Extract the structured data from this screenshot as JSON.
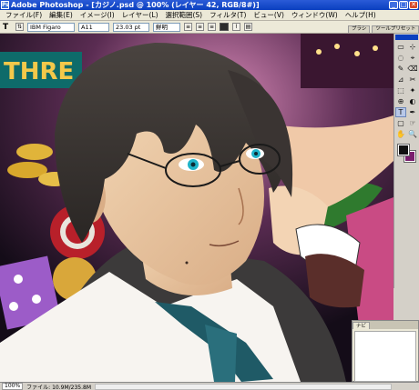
{
  "titlebar": {
    "title": "Adobe Photoshop - [カジノ.psd @ 100% (レイヤー 42, RGB/8#)]",
    "minimize": "_",
    "maximize": "□",
    "close": "✕"
  },
  "menu": [
    "ファイル(F)",
    "編集(E)",
    "イメージ(I)",
    "レイヤー(L)",
    "選択範囲(S)",
    "フィルタ(T)",
    "ビュー(V)",
    "ウィンドウ(W)",
    "ヘルプ(H)"
  ],
  "options": {
    "tool": "T",
    "font_family": "IBM Figaro",
    "font_style": "A11",
    "font_size": "23.03 pt",
    "antialias": "鮮明",
    "palette_tabs": [
      "ブラシ",
      "ツールプリセット"
    ]
  },
  "tools": [
    "▭",
    "⊹",
    "◌",
    "⌖",
    "✎",
    "⌫",
    "⊿",
    "✂",
    "⬚",
    "✦",
    "⊕",
    "◐",
    "T",
    "✒",
    "▢",
    "☞",
    "✋",
    "🔍"
  ],
  "navigator": {
    "tabs": [
      "ナビ"
    ]
  },
  "status": {
    "zoom": "100%",
    "info": "ファイル: 10.9M/235.8M"
  },
  "colors": {
    "foreground": "#111111",
    "background": "#7a1e6e",
    "titlebar": "#0a3fbf"
  }
}
